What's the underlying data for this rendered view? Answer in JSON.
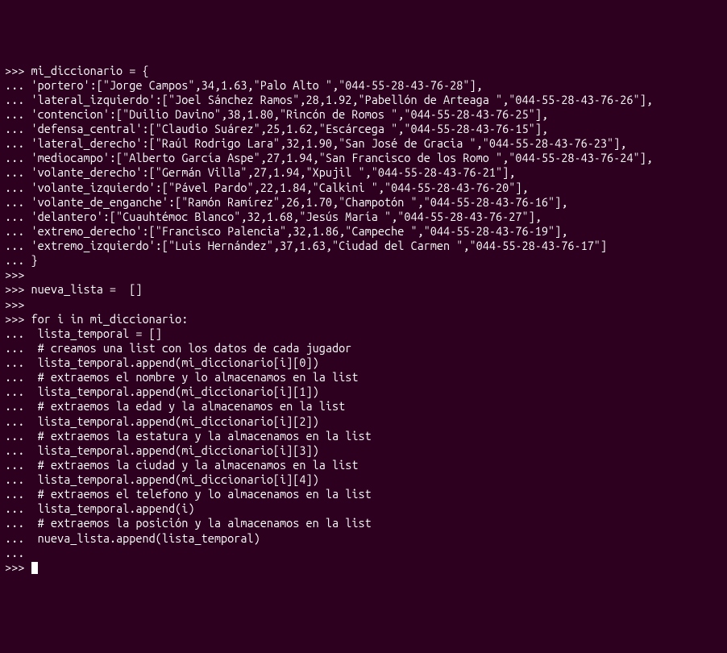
{
  "prompt_primary": ">>>",
  "prompt_cont": "...",
  "lines": [
    {
      "p": ">>>",
      "t": " mi_diccionario = {"
    },
    {
      "p": "...",
      "t": " 'portero':[\"Jorge Campos\",34,1.63,\"Palo Alto \",\"044-55-28-43-76-28\"],"
    },
    {
      "p": "...",
      "t": " 'lateral_izquierdo':[\"Joel Sánchez Ramos\",28,1.92,\"Pabellón de Arteaga \",\"044-55-28-43-76-26\"],"
    },
    {
      "p": "...",
      "t": " 'contencion':[\"Duilio Davino\",38,1.80,\"Rincón de Romos \",\"044-55-28-43-76-25\"],"
    },
    {
      "p": "...",
      "t": " 'defensa_central':[\"Claudio Suárez\",25,1.62,\"Escárcega \",\"044-55-28-43-76-15\"],"
    },
    {
      "p": "...",
      "t": " 'lateral_derecho':[\"Raúl Rodrigo Lara\",32,1.90,\"San José de Gracia \",\"044-55-28-43-76-23\"],"
    },
    {
      "p": "...",
      "t": " 'mediocampo':[\"Alberto García Aspe\",27,1.94,\"San Francisco de los Romo \",\"044-55-28-43-76-24\"],"
    },
    {
      "p": "...",
      "t": " 'volante_derecho':[\"Germán Villa\",27,1.94,\"Xpujil \",\"044-55-28-43-76-21\"],"
    },
    {
      "p": "...",
      "t": " 'volante_izquierdo':[\"Pável Pardo\",22,1.84,\"Calkini \",\"044-55-28-43-76-20\"],"
    },
    {
      "p": "...",
      "t": " 'volante_de_enganche':[\"Ramón Ramírez\",26,1.70,\"Champotón \",\"044-55-28-43-76-16\"],"
    },
    {
      "p": "...",
      "t": " 'delantero':[\"Cuauhtémoc Blanco\",32,1.68,\"Jesús María \",\"044-55-28-43-76-27\"],"
    },
    {
      "p": "...",
      "t": " 'extremo_derecho':[\"Francisco Palencia\",32,1.86,\"Campeche \",\"044-55-28-43-76-19\"],"
    },
    {
      "p": "...",
      "t": " 'extremo_izquierdo':[\"Luis Hernández\",37,1.63,\"Ciudad del Carmen \",\"044-55-28-43-76-17\"]"
    },
    {
      "p": "...",
      "t": " }"
    },
    {
      "p": ">>>",
      "t": ""
    },
    {
      "p": ">>>",
      "t": " nueva_lista =  []"
    },
    {
      "p": ">>>",
      "t": ""
    },
    {
      "p": ">>>",
      "t": " for i in mi_diccionario:"
    },
    {
      "p": "...",
      "t": "  lista_temporal = []"
    },
    {
      "p": "...",
      "t": "  # creamos una list con los datos de cada jugador"
    },
    {
      "p": "...",
      "t": "  lista_temporal.append(mi_diccionario[i][0])"
    },
    {
      "p": "...",
      "t": "  # extraemos el nombre y lo almacenamos en la list"
    },
    {
      "p": "...",
      "t": "  lista_temporal.append(mi_diccionario[i][1])"
    },
    {
      "p": "...",
      "t": "  # extraemos la edad y la almacenamos en la list"
    },
    {
      "p": "...",
      "t": "  lista_temporal.append(mi_diccionario[i][2])"
    },
    {
      "p": "...",
      "t": "  # extraemos la estatura y la almacenamos en la list"
    },
    {
      "p": "...",
      "t": "  lista_temporal.append(mi_diccionario[i][3])"
    },
    {
      "p": "...",
      "t": "  # extraemos la ciudad y la almacenamos en la list"
    },
    {
      "p": "...",
      "t": "  lista_temporal.append(mi_diccionario[i][4])"
    },
    {
      "p": "...",
      "t": "  # extraemos el telefono y lo almacenamos en la list"
    },
    {
      "p": "...",
      "t": "  lista_temporal.append(i)"
    },
    {
      "p": "...",
      "t": "  # extraemos la posición y la almacenamos en la list"
    },
    {
      "p": "...",
      "t": "  nueva_lista.append(lista_temporal)"
    },
    {
      "p": "...",
      "t": ""
    },
    {
      "p": ">>>",
      "t": " ",
      "cursor": true
    }
  ]
}
